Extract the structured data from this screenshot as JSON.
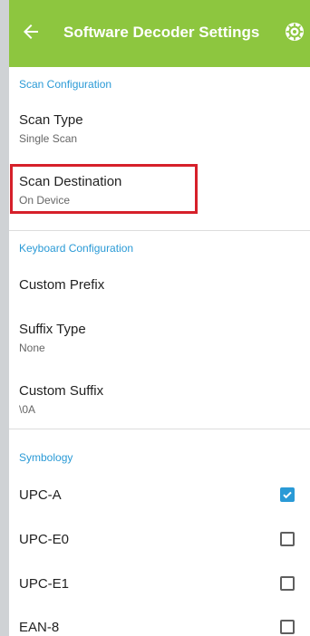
{
  "toolbar": {
    "title": "Software Decoder Settings",
    "back_icon": "arrow-left-icon",
    "settings_icon": "settings-cog-icon",
    "background_color": "#8dc63f"
  },
  "sections": {
    "scan": {
      "header": "Scan Configuration",
      "items": [
        {
          "title": "Scan Type",
          "summary": "Single Scan"
        },
        {
          "title": "Scan Destination",
          "summary": "On Device"
        }
      ]
    },
    "keyboard": {
      "header": "Keyboard Configuration",
      "items": [
        {
          "title": "Custom Prefix",
          "summary": ""
        },
        {
          "title": "Suffix Type",
          "summary": "None"
        },
        {
          "title": "Custom Suffix",
          "summary": "\\0A"
        }
      ]
    },
    "symbology": {
      "header": "Symbology",
      "items": [
        {
          "title": "UPC-A",
          "checked": true
        },
        {
          "title": "UPC-E0",
          "checked": false
        },
        {
          "title": "UPC-E1",
          "checked": false
        },
        {
          "title": "EAN-8",
          "checked": false
        }
      ]
    }
  },
  "colors": {
    "accent": "#2a9ad6",
    "highlight": "#d6202a"
  }
}
